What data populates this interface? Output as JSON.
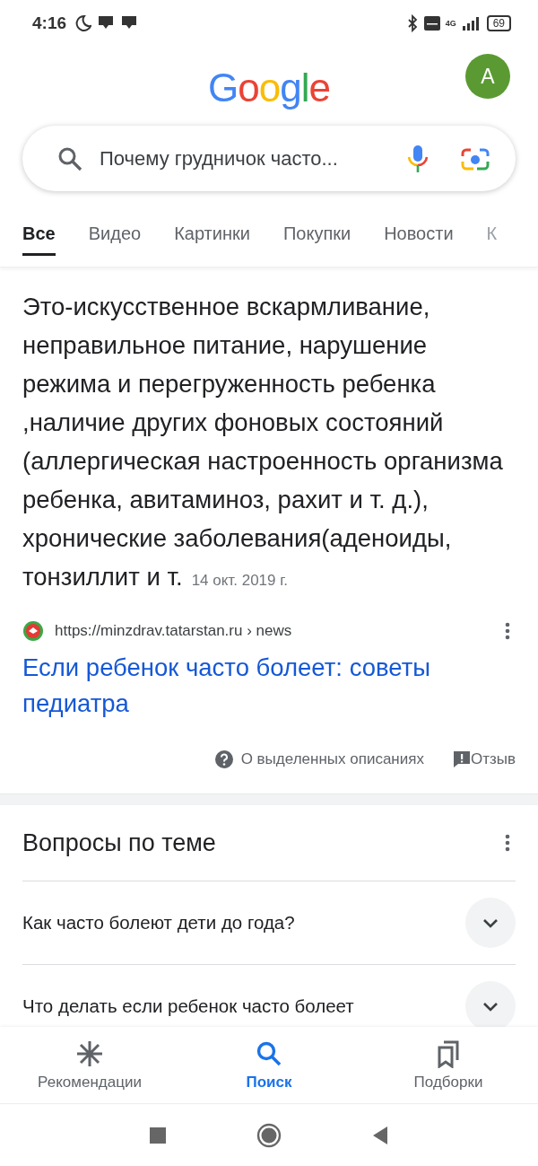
{
  "status_bar": {
    "time": "4:16",
    "battery": "69",
    "network": "4G"
  },
  "header": {
    "logo": "Google",
    "avatar": "A"
  },
  "search": {
    "value": "Почему грудничок часто..."
  },
  "tabs": [
    {
      "label": "Все",
      "selected": true
    },
    {
      "label": "Видео",
      "selected": false
    },
    {
      "label": "Картинки",
      "selected": false
    },
    {
      "label": "Покупки",
      "selected": false
    },
    {
      "label": "Новости",
      "selected": false
    },
    {
      "label": "К",
      "selected": false
    }
  ],
  "featured_snippet": {
    "text": "Это-искусственное вскармливание, неправильное питание, нарушение режима и перегруженность ребенка ,наличие других фоновых состояний (аллергическая настроенность организма ребенка, авитаминоз, рахит и т. д.), хронические заболевания(аденоиды, тонзиллит и т.",
    "date": "14 окт. 2019 г.",
    "url": "https://minzdrav.tatarstan.ru › news",
    "title": "Если ребенок часто болеет: советы педиатра",
    "about": "О выделенных описаниях",
    "feedback": "Отзыв"
  },
  "related_questions": {
    "title": "Вопросы по теме",
    "items": [
      {
        "text": "Как часто болеют дети до года?",
        "expanded": false
      },
      {
        "text": "Что делать если ребенок часто болеет",
        "expanded": false
      }
    ]
  },
  "bottom_nav": [
    {
      "label": "Рекомендации",
      "kind": "discover",
      "selected": false
    },
    {
      "label": "Поиск",
      "kind": "search",
      "selected": true
    },
    {
      "label": "Подборки",
      "kind": "collections",
      "selected": false
    }
  ]
}
